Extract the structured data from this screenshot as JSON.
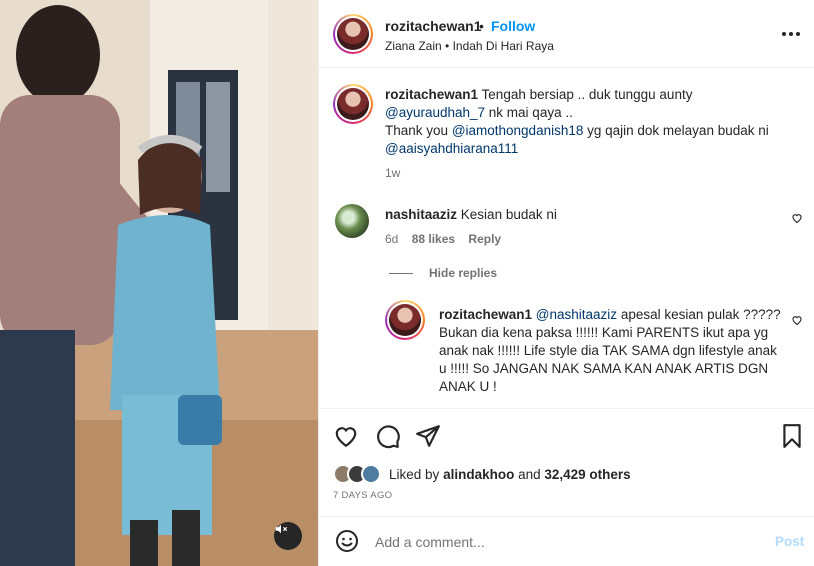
{
  "header": {
    "username": "rozitachewan1",
    "separator": "•",
    "follow_label": "Follow",
    "audio": "Ziana Zain • Indah Di Hari Raya"
  },
  "caption": {
    "username": "rozitachewan1",
    "text_1": "Tengah bersiap .. duk tunggu aunty",
    "mention_1": "@ayuraudhah_7",
    "text_2": "nk mai qaya ..",
    "text_3": "Thank you",
    "mention_2": "@iamothongdanish18",
    "text_4": "yg qajin dok melayan budak ni",
    "mention_3": "@aaisyahdhiarana111",
    "time": "1w"
  },
  "comments": [
    {
      "username": "nashitaaziz",
      "text": "Kesian budak ni",
      "time": "6d",
      "likes": "88 likes",
      "reply_label": "Reply"
    }
  ],
  "hide_replies_label": "Hide replies",
  "reply": {
    "username": "rozitachewan1",
    "mention": "@nashitaaziz",
    "text": "apesal kesian pulak ????? Bukan dia kena paksa !!!!!! Kami PARENTS ikut apa yg anak nak !!!!!! Life style dia TAK SAMA dgn lifestyle anak u !!!!! So JANGAN NAK SAMA KAN ANAK ARTIS DGN ANAK U !"
  },
  "likes": {
    "prefix": "Liked by",
    "user": "alindakhoo",
    "conjunction": "and",
    "others": "32,429 others"
  },
  "date": "7 DAYS AGO",
  "comment_box": {
    "placeholder": "Add a comment...",
    "post_label": "Post"
  },
  "colors": {
    "accent": "#0095f6",
    "mention": "#00376b",
    "muted": "#737373",
    "post_disabled": "#b3dbff"
  },
  "icons": [
    "mute-icon",
    "more-icon",
    "heart-icon",
    "comment-icon",
    "share-icon",
    "bookmark-icon",
    "emoji-icon"
  ]
}
